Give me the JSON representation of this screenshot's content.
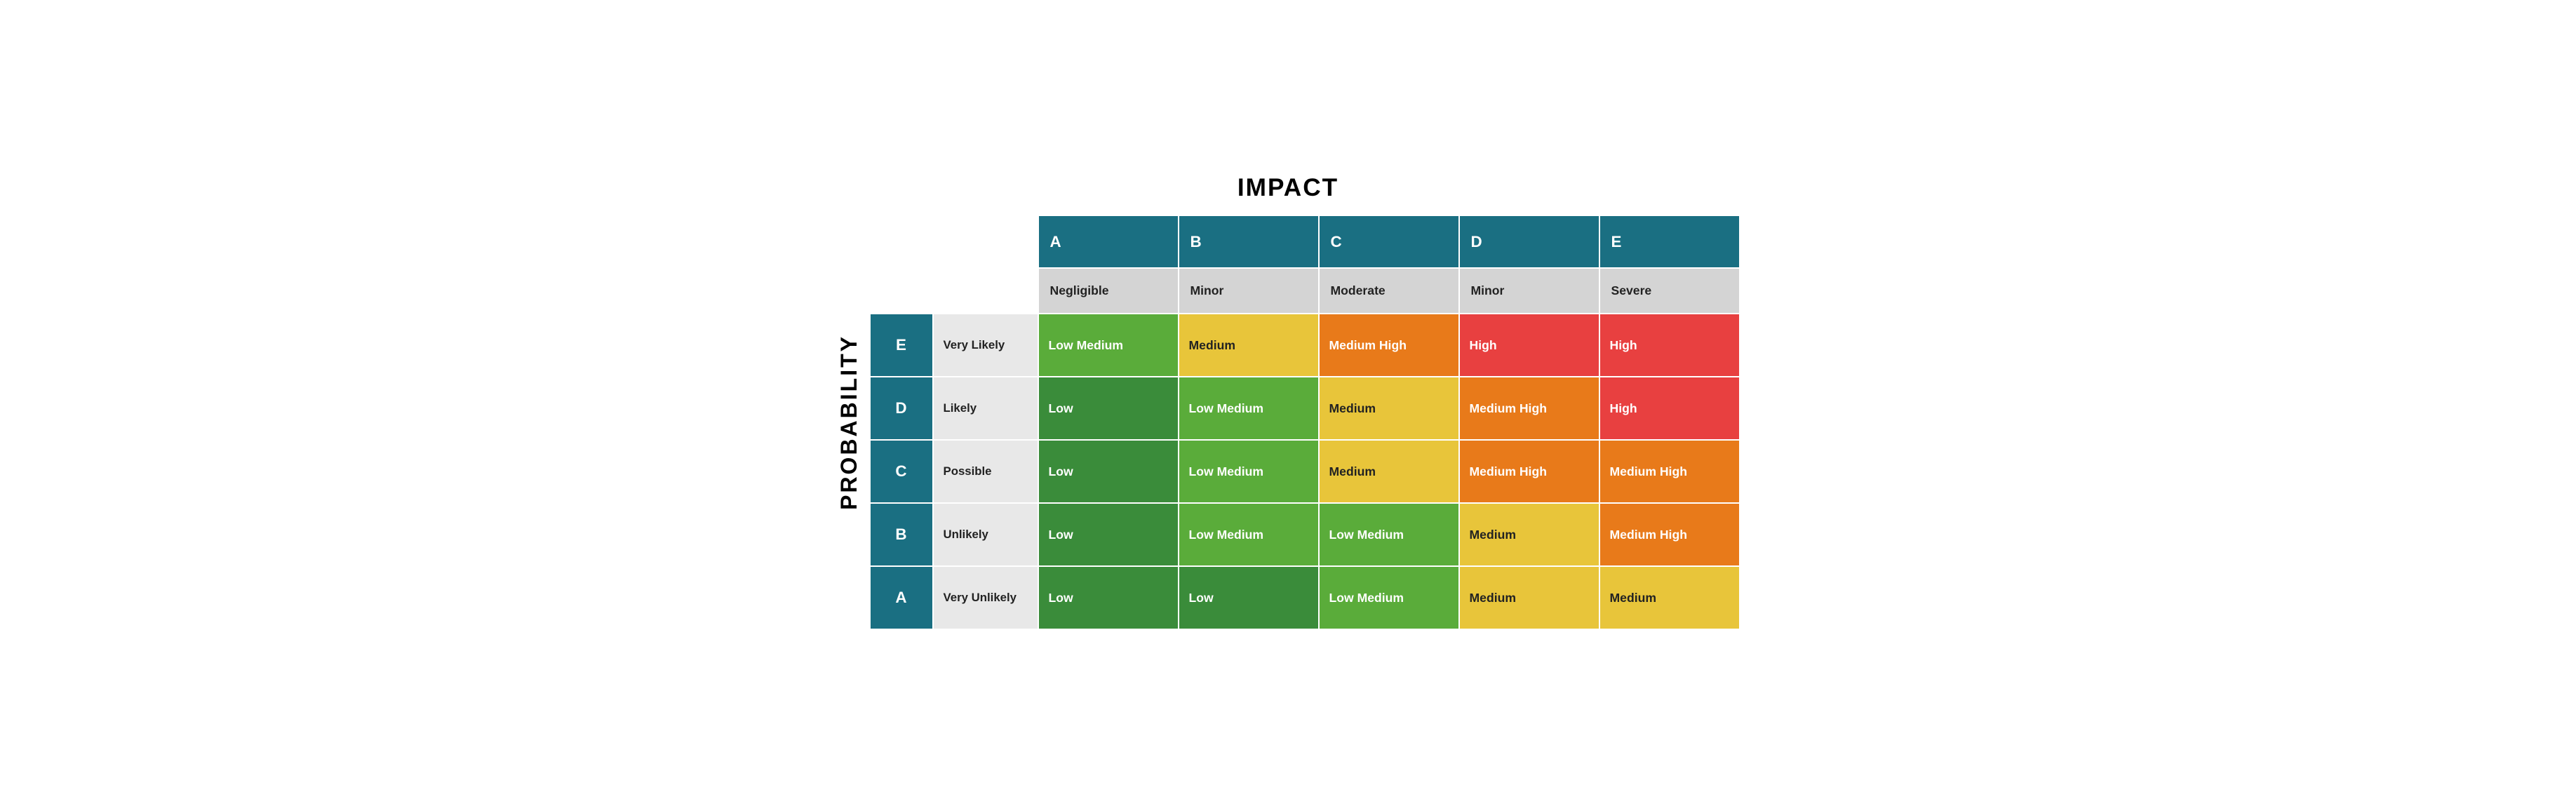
{
  "title": "IMPACT",
  "probability_label": "PROBABILITY",
  "columns": {
    "letters": [
      "A",
      "B",
      "C",
      "D",
      "E"
    ],
    "impact_labels": [
      "Negligible",
      "Minor",
      "Moderate",
      "Minor",
      "Severe"
    ]
  },
  "rows": [
    {
      "letter": "E",
      "label": "Very Likely",
      "cells": [
        {
          "text": "Low Medium",
          "color": "low-medium"
        },
        {
          "text": "Medium",
          "color": "medium"
        },
        {
          "text": "Medium High",
          "color": "medium-high"
        },
        {
          "text": "High",
          "color": "high"
        },
        {
          "text": "High",
          "color": "high"
        }
      ]
    },
    {
      "letter": "D",
      "label": "Likely",
      "cells": [
        {
          "text": "Low",
          "color": "low"
        },
        {
          "text": "Low Medium",
          "color": "low-medium"
        },
        {
          "text": "Medium",
          "color": "medium"
        },
        {
          "text": "Medium High",
          "color": "medium-high"
        },
        {
          "text": "High",
          "color": "high"
        }
      ]
    },
    {
      "letter": "C",
      "label": "Possible",
      "cells": [
        {
          "text": "Low",
          "color": "low"
        },
        {
          "text": "Low Medium",
          "color": "low-medium"
        },
        {
          "text": "Medium",
          "color": "medium"
        },
        {
          "text": "Medium High",
          "color": "medium-high"
        },
        {
          "text": "Medium High",
          "color": "medium-high"
        }
      ]
    },
    {
      "letter": "B",
      "label": "Unlikely",
      "cells": [
        {
          "text": "Low",
          "color": "low"
        },
        {
          "text": "Low Medium",
          "color": "low-medium"
        },
        {
          "text": "Low Medium",
          "color": "low-medium"
        },
        {
          "text": "Medium",
          "color": "medium"
        },
        {
          "text": "Medium High",
          "color": "medium-high"
        }
      ]
    },
    {
      "letter": "A",
      "label": "Very Unlikely",
      "cells": [
        {
          "text": "Low",
          "color": "low"
        },
        {
          "text": "Low",
          "color": "low"
        },
        {
          "text": "Low Medium",
          "color": "low-medium"
        },
        {
          "text": "Medium",
          "color": "medium"
        },
        {
          "text": "Medium",
          "color": "medium"
        }
      ]
    }
  ]
}
